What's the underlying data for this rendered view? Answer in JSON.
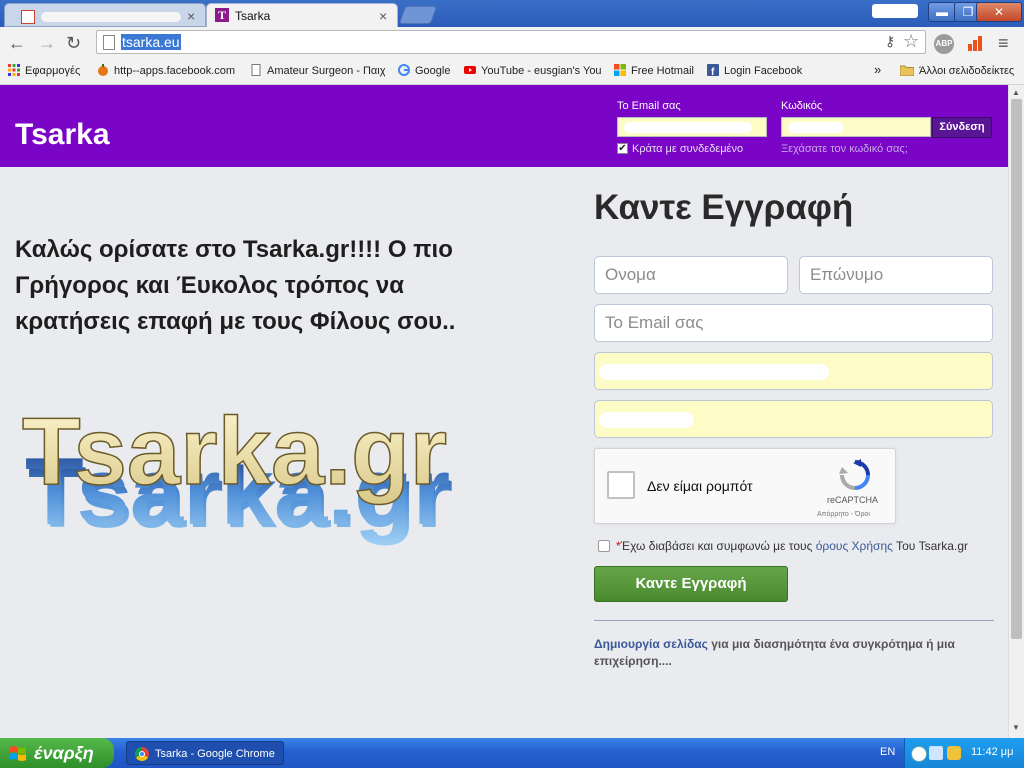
{
  "browser": {
    "tab2_title": "Tsarka",
    "tab2_favicon": "T",
    "tab_close": "×",
    "url": "tsarka.eu",
    "window_buttons": {
      "minimize": "▬",
      "restore": "❐",
      "close": "✕"
    },
    "nav_icons": {
      "back": "←",
      "forward": "→",
      "reload": "↻",
      "key": "⚷",
      "star": "☆",
      "menu": "≡"
    },
    "abp_label": "ABP"
  },
  "bookmarks": {
    "items": [
      {
        "label": "Εφαρμογές"
      },
      {
        "label": "http--apps.facebook.com"
      },
      {
        "label": "Amateur Surgeon - Παιχνίδια"
      },
      {
        "label": "Google"
      },
      {
        "label": "YouTube - eusgian's YouTube"
      },
      {
        "label": "Free Hotmail"
      },
      {
        "label": "Login Facebook"
      }
    ],
    "overflow": "»",
    "other_folder": "Άλλοι σελιδοδείκτες"
  },
  "header": {
    "logo": "Tsarka",
    "email_label": "Το Email σας",
    "password_label": "Κωδικός",
    "login_button": "Σύνδεση",
    "keep_logged": "Κράτα με συνδεδεμένο",
    "keep_check_mark": "✔",
    "forgot": "Ξεχάσατε τον κωδικό σας;"
  },
  "welcome": {
    "text": "Καλώς ορίσατε στο Tsarka.gr!!!! Ο πιο Γρήγορος και Έυκολος τρόπος να κρατήσεις επαφή με τους Φίλους σου..",
    "big_logo": "Tsarka.gr"
  },
  "register": {
    "title": "Καντε Εγγραφή",
    "first_name_placeholder": "Ονομα",
    "last_name_placeholder": "Επώνυμο",
    "email_placeholder": "Το Email σας",
    "recaptcha_label": "Δεν είμαι ρομπότ",
    "recaptcha_brand": "reCAPTCHA",
    "recaptcha_terms": "Απόρρητο - Όροι",
    "terms_required": "*",
    "terms_text_before": "Έχω διαβάσει και συμφωνώ με τους ",
    "terms_link": "όρους Χρήσης",
    "terms_text_after": " Του Tsarka.gr",
    "submit": "Καντε Εγγραφή",
    "create_page_link": "Δημιουργία σελίδας",
    "create_page_text": " για μια διασημότητα ένα συγκρότημα ή μια επιχείρηση...."
  },
  "taskbar": {
    "start": "έναρξη",
    "window_item": "Tsarka - Google Chrome",
    "lang": "EN",
    "clock": "11:42 μμ"
  },
  "scroll_icons": {
    "up": "▲",
    "down": "▼"
  }
}
